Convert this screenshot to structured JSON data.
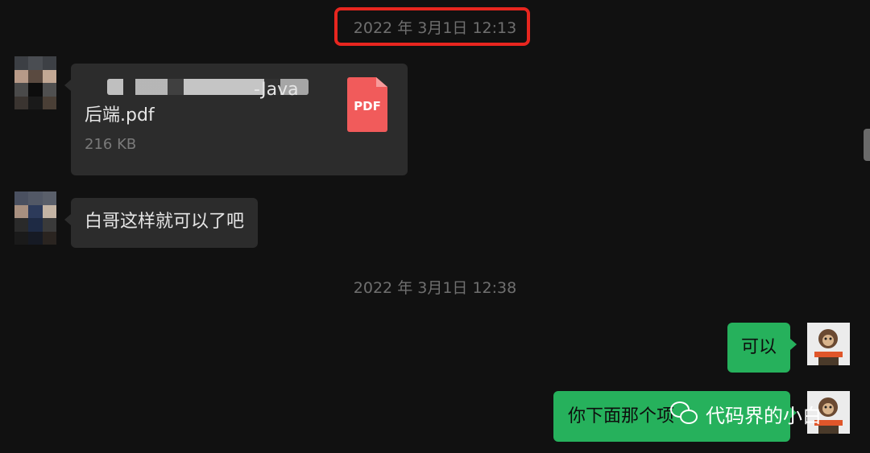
{
  "chat": {
    "timestamp_1": "2022 年 3月1日 12:13",
    "timestamp_2": "2022 年 3月1日 12:38",
    "messages": [
      {
        "sender": "contact",
        "type": "file",
        "file_name": "·Java 后端.pdf",
        "file_name_line1": "-Java",
        "file_name_line2": "后端.pdf",
        "file_size": "216 KB",
        "file_icon_label": "PDF"
      },
      {
        "sender": "contact",
        "type": "text",
        "text": "白哥这样就可以了吧"
      },
      {
        "sender": "me",
        "type": "text",
        "text": "可以"
      },
      {
        "sender": "me",
        "type": "text",
        "text": "你下面那个项"
      }
    ]
  },
  "watermark": {
    "text": "代码界的小白",
    "icon": "wechat-icon"
  },
  "colors": {
    "background": "#111111",
    "incoming_bubble": "#2c2c2c",
    "outgoing_bubble": "#26b15c",
    "highlight_box": "#e8261f",
    "pdf_icon": "#f15b5b"
  }
}
